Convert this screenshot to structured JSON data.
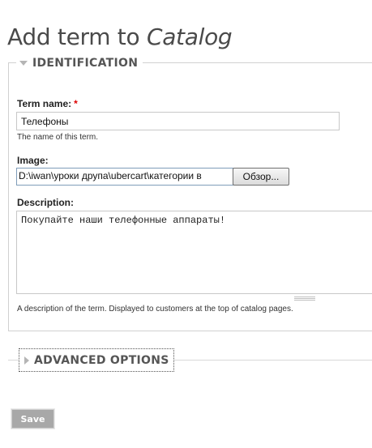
{
  "page": {
    "title_prefix": "Add term to",
    "title_vocabulary": "Catalog"
  },
  "identification": {
    "legend": "IDENTIFICATION",
    "term_name": {
      "label": "Term name:",
      "required_mark": "*",
      "value": "Телефоны",
      "hint": "The name of this term."
    },
    "image": {
      "label": "Image:",
      "value": "D:\\iwan\\уроки друпа\\ubercart\\категории в",
      "browse_label": "Обзор..."
    },
    "description": {
      "label": "Description:",
      "value": "Покупайте наши телефонные аппараты!",
      "hint": "A description of the term. Displayed to customers at the top of catalog pages."
    }
  },
  "advanced": {
    "legend": "ADVANCED OPTIONS"
  },
  "actions": {
    "save_label": "Save"
  },
  "colors": {
    "required": "#dd0000",
    "save_button_bg": "#a8a8a8"
  }
}
